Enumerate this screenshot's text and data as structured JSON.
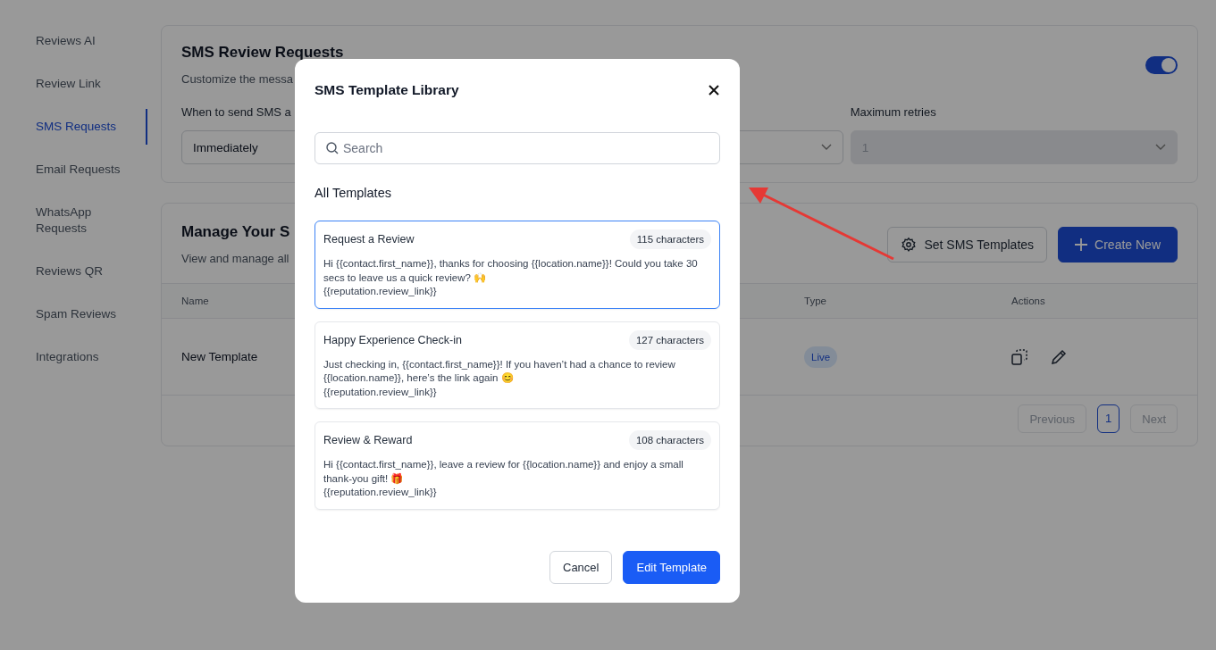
{
  "sidebar": {
    "items": [
      {
        "label": "Reviews AI",
        "selected": false
      },
      {
        "label": "Review Link",
        "selected": false
      },
      {
        "label": "SMS Requests",
        "selected": true
      },
      {
        "label": "Email Requests",
        "selected": false
      },
      {
        "label": "WhatsApp Requests",
        "selected": false
      },
      {
        "label": "Reviews QR",
        "selected": false
      },
      {
        "label": "Spam Reviews",
        "selected": false
      },
      {
        "label": "Integrations",
        "selected": false
      }
    ]
  },
  "settings_card": {
    "title": "SMS Review Requests",
    "description": "Customize the messa",
    "enabled": true,
    "fields": [
      {
        "label": "When to send SMS a",
        "value": "Immediately",
        "disabled": false
      },
      {
        "disabled": false
      },
      {
        "label": "Maximum retries",
        "value": "1",
        "disabled": true
      }
    ]
  },
  "templates_card": {
    "title": "Manage Your S",
    "description": "View and manage all",
    "buttons": [
      {
        "label": "Set SMS Templates",
        "kind": "settings"
      },
      {
        "label": "Create New",
        "kind": "create"
      }
    ],
    "columns": [
      "Name",
      "Type",
      "Actions"
    ],
    "rows": [
      {
        "name": "New Template",
        "type": "Live"
      }
    ],
    "pagination": {
      "previous": "Previous",
      "pages": [
        {
          "label": "1",
          "selected": true
        }
      ],
      "next": "Next"
    }
  },
  "modal": {
    "title": "SMS Template Library",
    "search": {
      "placeholder": "Search"
    },
    "section": "All Templates",
    "templates": [
      {
        "name": "Request a Review",
        "count": "115 characters",
        "selected": true,
        "body": [
          "Hi {{contact.first_name}}, thanks for choosing {{location.name}}! Could you take 30 secs to leave us a quick review? 🙌",
          "{{reputation.review_link}}"
        ]
      },
      {
        "name": "Happy Experience Check-in",
        "count": "127 characters",
        "selected": false,
        "body": [
          "Just checking in, {{contact.first_name}}! If you haven’t had a chance to review {{location.name}}, here’s the link again 😊",
          "{{reputation.review_link}}"
        ]
      },
      {
        "name": "Review & Reward",
        "count": "108 characters",
        "selected": false,
        "body": [
          "Hi {{contact.first_name}}, leave a review for {{location.name}} and enjoy a small thank-you gift! 🎁",
          "{{reputation.review_link}}"
        ]
      }
    ],
    "buttons": [
      {
        "label": "Cancel",
        "kind": "secondary"
      },
      {
        "label": "Edit Template",
        "kind": "primary"
      }
    ]
  }
}
